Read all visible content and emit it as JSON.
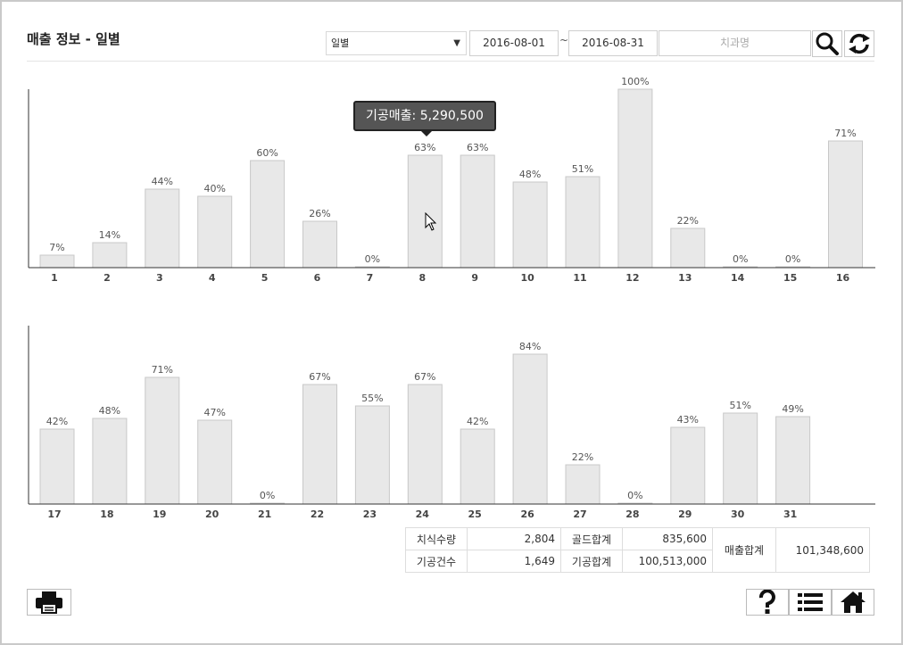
{
  "header": {
    "title": "매출 정보 - 일별",
    "period_select": "일별",
    "date_from": "2016-08-01",
    "date_separator": "~",
    "date_to": "2016-08-31",
    "search_placeholder": "치과명"
  },
  "tooltip": {
    "text": "기공매출: 5,290,500"
  },
  "chart_data": [
    {
      "type": "bar",
      "categories": [
        "1",
        "2",
        "3",
        "4",
        "5",
        "6",
        "7",
        "8",
        "9",
        "10",
        "11",
        "12",
        "13",
        "14",
        "15",
        "16"
      ],
      "values": [
        7,
        14,
        44,
        40,
        60,
        26,
        0,
        63,
        63,
        48,
        51,
        100,
        22,
        0,
        0,
        71
      ],
      "labels": [
        "7%",
        "14%",
        "44%",
        "40%",
        "60%",
        "26%",
        "0%",
        "63%",
        "63%",
        "48%",
        "51%",
        "100%",
        "22%",
        "0%",
        "0%",
        "71%"
      ],
      "ylim": [
        0,
        100
      ],
      "grid": false
    },
    {
      "type": "bar",
      "categories": [
        "17",
        "18",
        "19",
        "20",
        "21",
        "22",
        "23",
        "24",
        "25",
        "26",
        "27",
        "28",
        "29",
        "30",
        "31"
      ],
      "values": [
        42,
        48,
        71,
        47,
        0,
        67,
        55,
        67,
        42,
        84,
        22,
        0,
        43,
        51,
        49
      ],
      "labels": [
        "42%",
        "48%",
        "71%",
        "47%",
        "0%",
        "67%",
        "55%",
        "67%",
        "42%",
        "84%",
        "22%",
        "0%",
        "43%",
        "51%",
        "49%"
      ],
      "ylim": [
        0,
        100
      ],
      "grid": false
    }
  ],
  "summary": {
    "rows": [
      [
        {
          "label": "치식수량",
          "value": "2,804"
        },
        {
          "label": "골드합계",
          "value": "835,600"
        }
      ],
      [
        {
          "label": "기공건수",
          "value": "1,649"
        },
        {
          "label": "기공합계",
          "value": "100,513,000"
        }
      ]
    ],
    "total_label": "매출합계",
    "total_value": "101,348,600"
  },
  "colors": {
    "bar_fill": "#e8e8e8",
    "bar_stroke": "#c8c8c8",
    "axis": "#333333",
    "tooltip_bg": "#555555"
  },
  "icons": {
    "search": "search-icon",
    "refresh": "refresh-icon",
    "print": "print-icon",
    "help": "help-icon",
    "list": "list-icon",
    "home": "home-icon"
  }
}
